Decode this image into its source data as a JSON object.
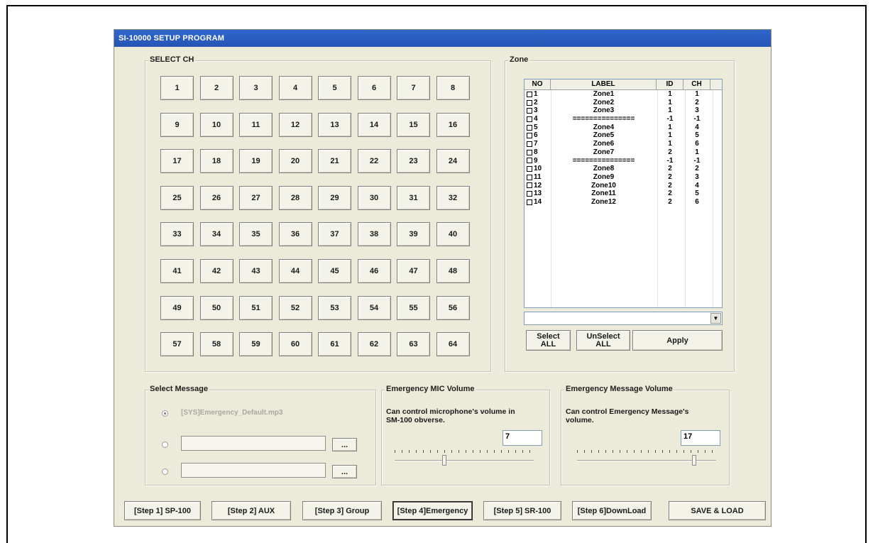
{
  "window": {
    "title": "SI-10000 SETUP PROGRAM"
  },
  "select_ch": {
    "legend": "SELECT CH",
    "buttons": [
      "1",
      "2",
      "3",
      "4",
      "5",
      "6",
      "7",
      "8",
      "9",
      "10",
      "11",
      "12",
      "13",
      "14",
      "15",
      "16",
      "17",
      "18",
      "19",
      "20",
      "21",
      "22",
      "23",
      "24",
      "25",
      "26",
      "27",
      "28",
      "29",
      "30",
      "31",
      "32",
      "33",
      "34",
      "35",
      "36",
      "37",
      "38",
      "39",
      "40",
      "41",
      "42",
      "43",
      "44",
      "45",
      "46",
      "47",
      "48",
      "49",
      "50",
      "51",
      "52",
      "53",
      "54",
      "55",
      "56",
      "57",
      "58",
      "59",
      "60",
      "61",
      "62",
      "63",
      "64"
    ]
  },
  "zone": {
    "legend": "Zone",
    "columns": [
      "NO",
      "LABEL",
      "ID",
      "CH"
    ],
    "rows": [
      {
        "no": "1",
        "label": "Zone1",
        "id": "1",
        "ch": "1"
      },
      {
        "no": "2",
        "label": "Zone2",
        "id": "1",
        "ch": "2"
      },
      {
        "no": "3",
        "label": "Zone3",
        "id": "1",
        "ch": "3"
      },
      {
        "no": "4",
        "label": "===============",
        "id": "-1",
        "ch": "-1"
      },
      {
        "no": "5",
        "label": "Zone4",
        "id": "1",
        "ch": "4"
      },
      {
        "no": "6",
        "label": "Zone5",
        "id": "1",
        "ch": "5"
      },
      {
        "no": "7",
        "label": "Zone6",
        "id": "1",
        "ch": "6"
      },
      {
        "no": "8",
        "label": "Zone7",
        "id": "2",
        "ch": "1"
      },
      {
        "no": "9",
        "label": "===============",
        "id": "-1",
        "ch": "-1"
      },
      {
        "no": "10",
        "label": "Zone8",
        "id": "2",
        "ch": "2"
      },
      {
        "no": "11",
        "label": "Zone9",
        "id": "2",
        "ch": "3"
      },
      {
        "no": "12",
        "label": "Zone10",
        "id": "2",
        "ch": "4"
      },
      {
        "no": "13",
        "label": "Zone11",
        "id": "2",
        "ch": "5"
      },
      {
        "no": "14",
        "label": "Zone12",
        "id": "2",
        "ch": "6"
      }
    ],
    "combo_value": "",
    "select_all_line1": "Select",
    "select_all_line2": "ALL",
    "unselect_all_line1": "UnSelect",
    "unselect_all_line2": "ALL",
    "apply_label": "Apply"
  },
  "select_message": {
    "legend": "Select Message",
    "default_option": "[SYS]Emergency_Default.mp3",
    "browse_label": "...",
    "selected_option": 1
  },
  "mic_volume": {
    "legend": "Emergency MIC Volume",
    "description_line1": "Can control microphone's volume in",
    "description_line2": "SM-100  obverse.",
    "value": "7",
    "level": 0.35
  },
  "message_volume": {
    "legend": "Emergency Message Volume",
    "description_line1": "Can control Emergency Message's",
    "description_line2": "volume.",
    "value": "17",
    "level": 0.85
  },
  "steps": {
    "step1": "[Step 1]  SP-100",
    "step2": "[Step 2]  AUX",
    "step3": "[Step 3]  Group",
    "step4": "[Step 4]Emergency",
    "step5": "[Step 5]  SR-100",
    "step6": "[Step 6]DownLoad",
    "save": "SAVE & LOAD",
    "active": "step4"
  }
}
